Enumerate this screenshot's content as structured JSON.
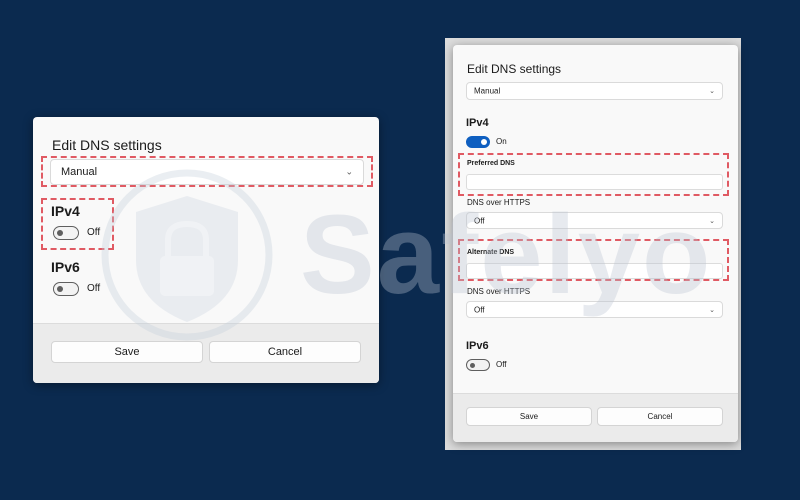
{
  "left_dialog": {
    "title": "Edit DNS settings",
    "mode_select": {
      "value": "Manual"
    },
    "ipv4": {
      "heading": "IPv4",
      "toggle_state": "off",
      "toggle_label": "Off"
    },
    "ipv6": {
      "heading": "IPv6",
      "toggle_state": "off",
      "toggle_label": "Off"
    },
    "save_label": "Save",
    "cancel_label": "Cancel"
  },
  "right_dialog": {
    "title": "Edit DNS settings",
    "mode_select": {
      "value": "Manual"
    },
    "ipv4": {
      "heading": "IPv4",
      "toggle_state": "on",
      "toggle_label": "On"
    },
    "preferred_dns": {
      "label": "Preferred DNS",
      "value": ""
    },
    "preferred_doh": {
      "label": "DNS over HTTPS",
      "value": "Off"
    },
    "alternate_dns": {
      "label": "Alternate DNS",
      "value": ""
    },
    "alternate_doh": {
      "label": "DNS over HTTPS",
      "value": "Off"
    },
    "ipv6": {
      "heading": "IPv6",
      "toggle_state": "off",
      "toggle_label": "Off"
    },
    "save_label": "Save",
    "cancel_label": "Cancel"
  },
  "watermark": {
    "brand": "Safelyo"
  },
  "colors": {
    "background": "#0b2a4f",
    "highlight": "#e05a63",
    "toggle_on": "#0f5fc0"
  }
}
